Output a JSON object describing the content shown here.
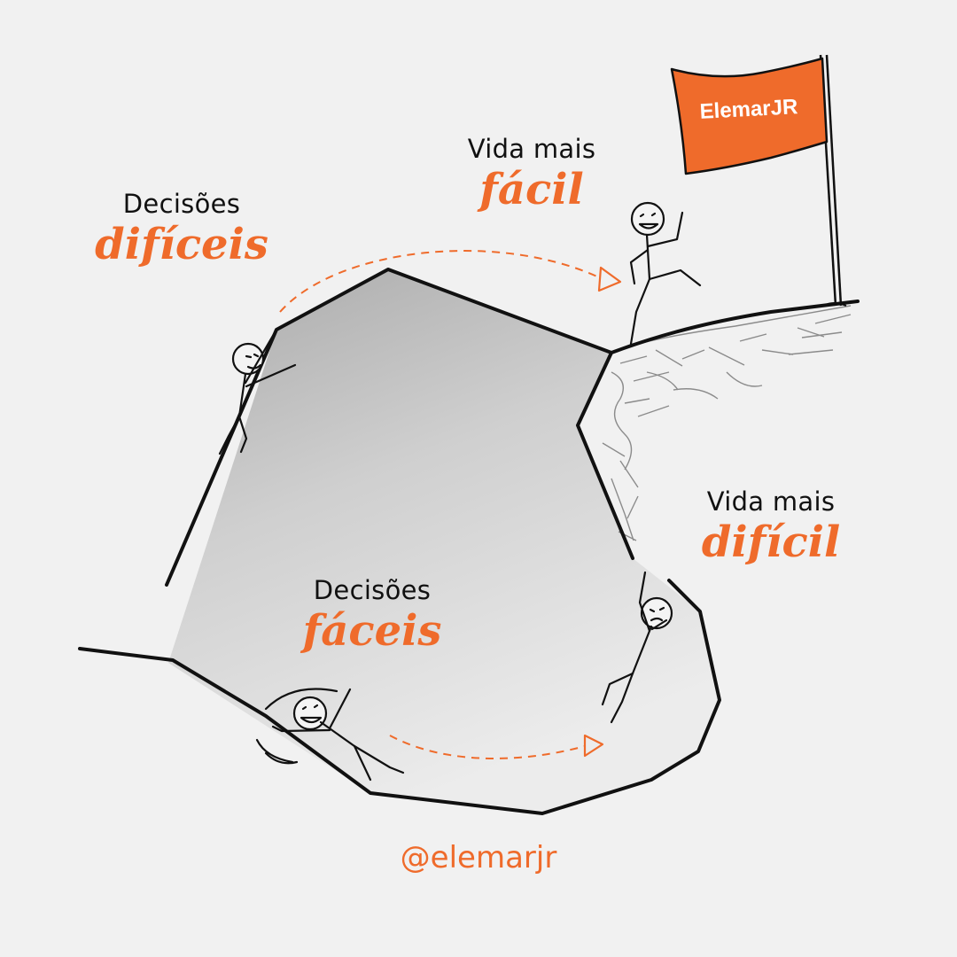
{
  "captions": {
    "hard_decisions": {
      "line1": "Decisões",
      "line2": "difíceis"
    },
    "easy_life": {
      "line1": "Vida mais",
      "line2": "fácil"
    },
    "easy_decisions": {
      "line1": "Decisões",
      "line2": "fáceis"
    },
    "hard_life": {
      "line1": "Vida mais",
      "line2": "difícil"
    }
  },
  "flag": {
    "brand": "ElemarJR"
  },
  "footer": {
    "handle": "@elemarjr"
  },
  "colors": {
    "accent": "#ef6b2b",
    "ink": "#111111",
    "rock": "#bdbdbd",
    "background": "#f1f1f1"
  }
}
